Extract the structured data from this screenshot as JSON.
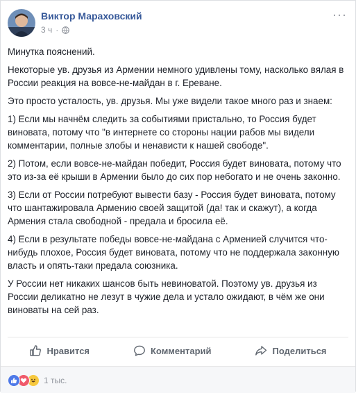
{
  "post": {
    "author": "Виктор Мараховский",
    "time": "3 ч",
    "separator": "·",
    "more_label": "···",
    "paragraphs": [
      "Минутка пояснений.",
      "Некоторые ув. друзья из Армении немного удивлены тому, насколько вялая в России реакция на вовсе-не-майдан в г. Ереване.",
      "Это просто усталость, ув. друзья. Мы уже видели такое много раз и знаем:",
      "1) Если мы начнём следить за событиями пристально, то Россия будет виновата, потому что \"в интернете со стороны нации рабов мы видели комментарии, полные злобы и ненависти к нашей свободе\".",
      "2) Потом, если вовсе-не-майдан победит, Россия будет виновата, потому что это из-за её крыши в Армении было до сих пор небогато и не очень законно.",
      "3) Если от России потребуют вывести базу - Россия будет виновата, потому что шантажировала Армению своей защитой (да! так и скажут), а когда Армения стала свободной - предала и бросила её.",
      "4) Если в результате победы вовсе-не-майдана с Арменией случится что-нибудь плохое, Россия будет виновата, потому что не поддержала законную власть и опять-таки предала союзника.",
      "У России нет никаких шансов быть невиноватой. Поэтому ув. друзья из России деликатно не лезут в чужие дела и устало ожидают, в чём же они виноваты на сей раз."
    ]
  },
  "actions": {
    "like": "Нравится",
    "comment": "Комментарий",
    "share": "Поделиться"
  },
  "reactions": {
    "icons": [
      "like-reaction-icon",
      "love-reaction-icon",
      "haha-reaction-icon"
    ],
    "count": "1 тыс."
  },
  "colors": {
    "author_link": "#365899",
    "muted": "#90949c",
    "action_text": "#606770"
  }
}
